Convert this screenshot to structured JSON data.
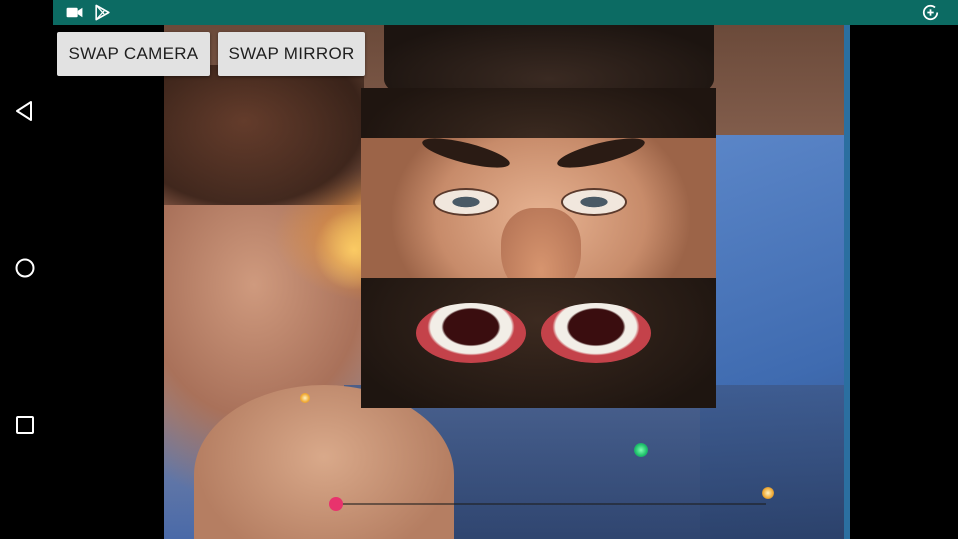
{
  "status_bar": {
    "color": "#0c6b63",
    "icons": [
      "video-camera-icon",
      "play-store-icon",
      "data-saver-icon"
    ]
  },
  "nav_bar": {
    "items": [
      "back-icon",
      "home-icon",
      "recents-icon"
    ]
  },
  "toolbar": {
    "swap_camera_label": "SWAP CAMERA",
    "swap_mirror_label": "SWAP MIRROR"
  },
  "seek_bar": {
    "accent_color": "#e8336d",
    "progress": 0.0
  }
}
